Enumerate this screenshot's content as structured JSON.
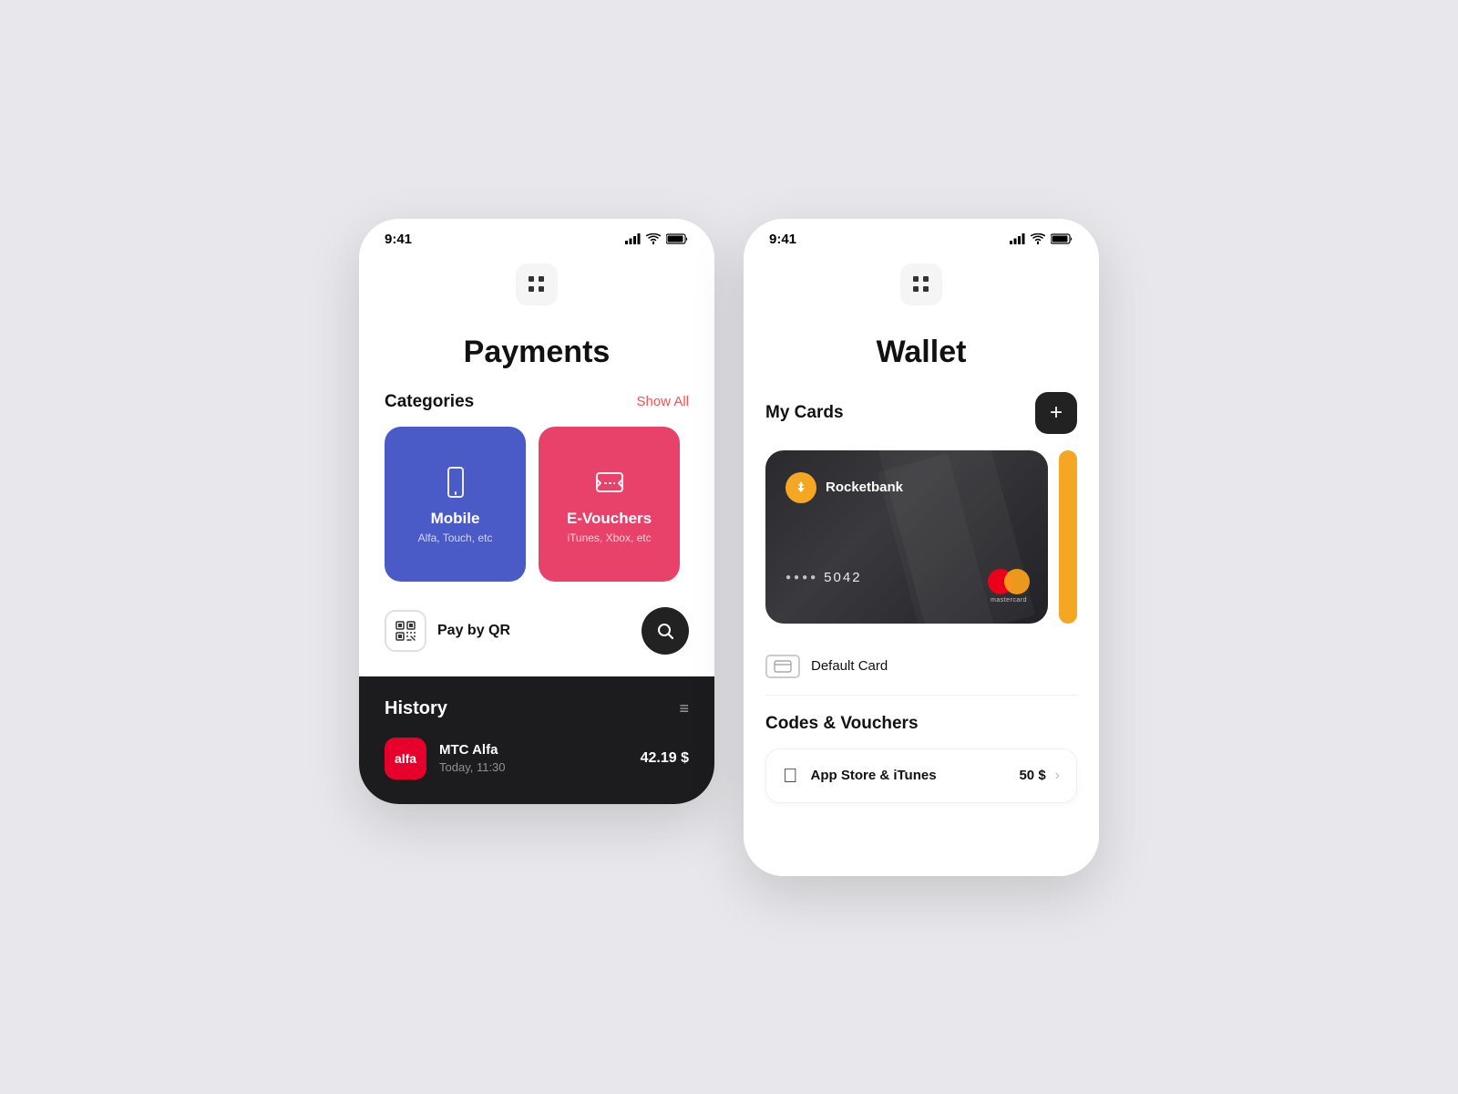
{
  "payments_screen": {
    "status_time": "9:41",
    "title": "Payments",
    "categories_label": "Categories",
    "show_all": "Show All",
    "categories": [
      {
        "name": "Mobile",
        "sub": "Alfa, Touch, etc",
        "color": "#4a5bc7",
        "icon": "phone"
      },
      {
        "name": "E-Vouchers",
        "sub": "iTunes, Xbox, etc",
        "color": "#e8426a",
        "icon": "voucher"
      }
    ],
    "pay_qr_label": "Pay by QR",
    "history_title": "History",
    "history_items": [
      {
        "logo_text": "alfa",
        "name": "MTC Alfa",
        "date": "Today, 11:30",
        "amount": "42.19 $"
      }
    ]
  },
  "wallet_screen": {
    "status_time": "9:41",
    "title": "Wallet",
    "my_cards_label": "My Cards",
    "add_card_label": "+",
    "card": {
      "bank_name": "Rocketbank",
      "number_dots": "••••",
      "number_last4": "5042",
      "network": "mastercard"
    },
    "default_card_label": "Default Card",
    "codes_vouchers_label": "Codes & Vouchers",
    "vouchers": [
      {
        "name": "App Store & iTunes",
        "amount": "50 $"
      }
    ]
  }
}
